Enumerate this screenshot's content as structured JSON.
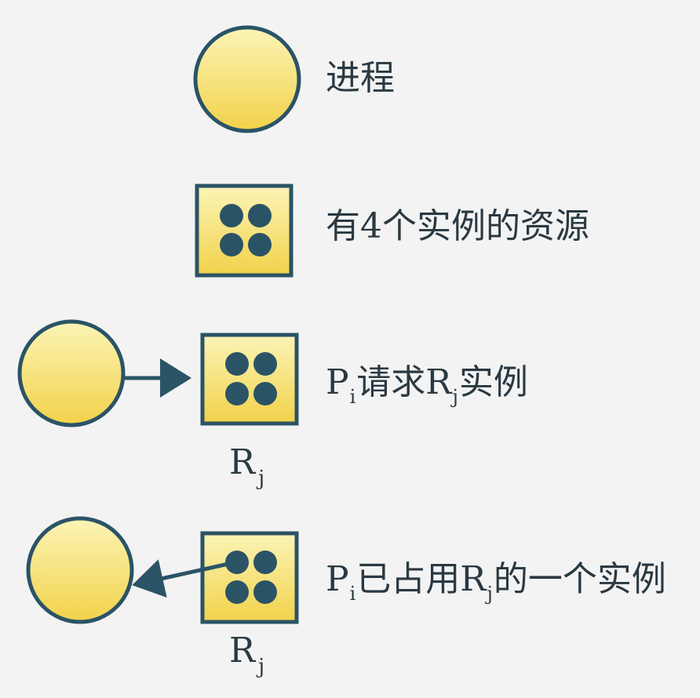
{
  "legend": {
    "process_label": "进程",
    "resource_label": "有4个实例的资源",
    "request": {
      "p": "P",
      "p_sub": "i",
      "mid": "请求",
      "r": "R",
      "r_sub": "j",
      "end": "实例"
    },
    "assignment": {
      "p": "P",
      "p_sub": "i",
      "mid": "已占用",
      "r": "R",
      "r_sub": "j",
      "end": "的一个实例"
    },
    "resource_name_request": {
      "r": "R",
      "r_sub": "j"
    },
    "resource_name_assign": {
      "r": "R",
      "r_sub": "j"
    }
  },
  "colors": {
    "background": "#f3f3f3",
    "node_fill_top": "#fbf4b6",
    "node_fill_bottom": "#f2d24a",
    "stroke": "#2b5366",
    "instance_dot": "#2b5366",
    "text": "#2a3942"
  },
  "icons": {
    "process": "circle-node",
    "resource": "square-node-4-dots",
    "arrow": "arrow-right"
  }
}
